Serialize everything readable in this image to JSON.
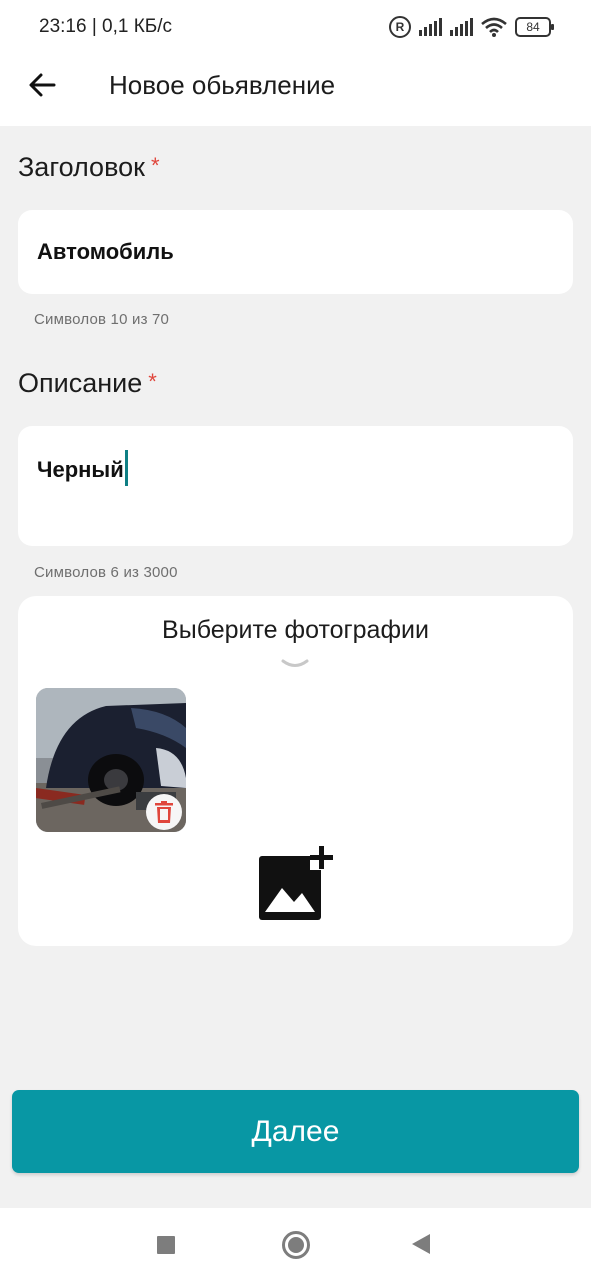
{
  "status_bar": {
    "time_speed": "23:16 | 0,1 КБ/с",
    "roaming_icon": "R",
    "battery": "84"
  },
  "header": {
    "back_icon": "arrow-left-icon",
    "title": "Новое обьявление"
  },
  "form": {
    "title_field": {
      "label": "Заголовок",
      "required_mark": "*",
      "value": "Автомобиль",
      "counter": "Символов 10 из 70"
    },
    "description_field": {
      "label": "Описание",
      "required_mark": "*",
      "value": "Черный",
      "counter": "Символов 6 из 3000"
    }
  },
  "photos": {
    "title": "Выберите фотографии",
    "delete_icon": "trash-icon",
    "add_icon": "add-photo-icon"
  },
  "next_button": {
    "label": "Далее"
  },
  "colors": {
    "accent": "#0897a4",
    "required": "#e0463c",
    "caret": "#0f7f84",
    "background": "#f1f1f1"
  }
}
